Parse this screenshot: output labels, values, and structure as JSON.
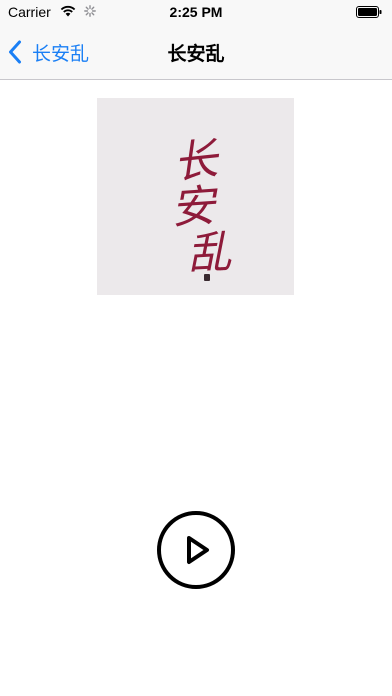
{
  "status_bar": {
    "carrier": "Carrier",
    "time": "2:25 PM",
    "wifi_icon": "wifi-icon",
    "activity_icon": "activity-spinner-icon",
    "battery_icon": "battery-icon"
  },
  "nav": {
    "back_label": "长安乱",
    "back_icon": "chevron-left-icon",
    "title": "长安乱",
    "accent_color": "#1a7ff5"
  },
  "cover": {
    "calligraphy_text": "长安乱",
    "ink_color": "#8e1b3a"
  },
  "player": {
    "play_icon": "play-icon"
  }
}
